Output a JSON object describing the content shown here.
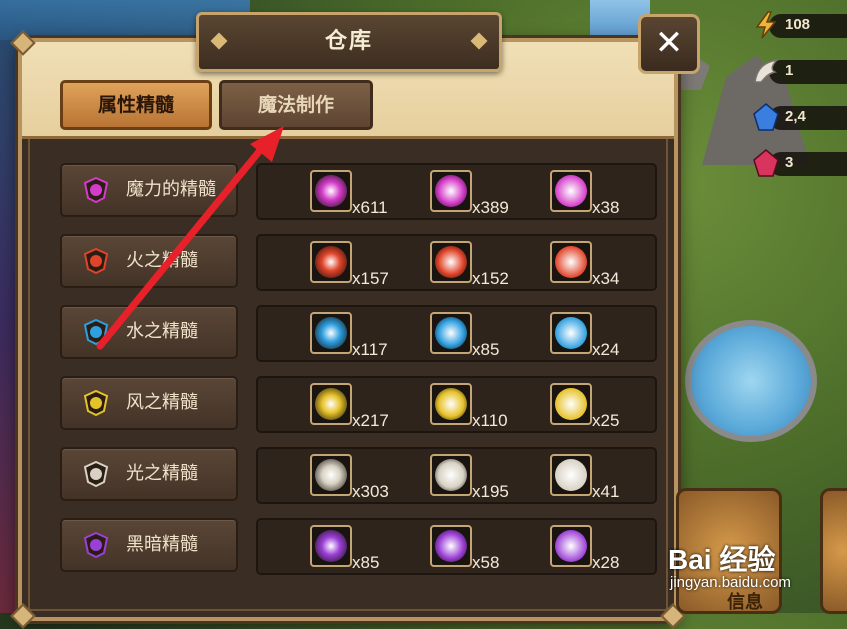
{
  "resources": [
    {
      "icon": "lightning-icon",
      "value": "108"
    },
    {
      "icon": "wing-icon",
      "value": "1"
    },
    {
      "icon": "blue-crystal-icon",
      "value": "2,4"
    },
    {
      "icon": "red-crystal-icon",
      "value": "3"
    }
  ],
  "window": {
    "title": "仓库",
    "close_label": "✕",
    "tabs": [
      {
        "label": "属性精髓",
        "active": true
      },
      {
        "label": "魔法制作",
        "active": false
      }
    ]
  },
  "rows": [
    {
      "label": "魔力的精髓",
      "color": "#d33cc8",
      "items": [
        {
          "count": "x611"
        },
        {
          "count": "x389"
        },
        {
          "count": "x38"
        }
      ]
    },
    {
      "label": "火之精髓",
      "color": "#e0442a",
      "items": [
        {
          "count": "x157"
        },
        {
          "count": "x152"
        },
        {
          "count": "x34"
        }
      ]
    },
    {
      "label": "水之精髓",
      "color": "#2f9fe0",
      "items": [
        {
          "count": "x117"
        },
        {
          "count": "x85"
        },
        {
          "count": "x24"
        }
      ]
    },
    {
      "label": "风之精髓",
      "color": "#e6c22a",
      "items": [
        {
          "count": "x217"
        },
        {
          "count": "x110"
        },
        {
          "count": "x25"
        }
      ]
    },
    {
      "label": "光之精髓",
      "color": "#d8d2c4",
      "items": [
        {
          "count": "x303"
        },
        {
          "count": "x195"
        },
        {
          "count": "x41"
        }
      ]
    },
    {
      "label": "黑暗精髓",
      "color": "#9b3fd6",
      "items": [
        {
          "count": "x85"
        },
        {
          "count": "x58"
        },
        {
          "count": "x28"
        }
      ]
    }
  ],
  "bottom_button_label": "信息",
  "watermark": {
    "text": "Bai 经验",
    "url": "jingyan.baidu.com"
  }
}
